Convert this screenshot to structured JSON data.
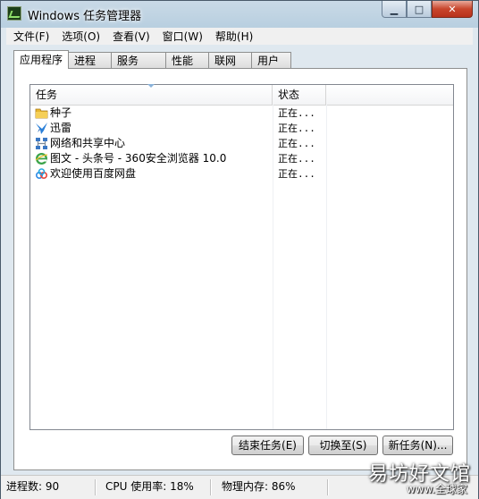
{
  "window": {
    "title": "Windows 任务管理器"
  },
  "menu": [
    "文件(F)",
    "选项(O)",
    "查看(V)",
    "窗口(W)",
    "帮助(H)"
  ],
  "tabs": [
    "应用程序",
    "进程",
    "服务",
    "性能",
    "联网",
    "用户"
  ],
  "columns": {
    "task": "任务",
    "status": "状态"
  },
  "rows": [
    {
      "name": "种子",
      "status": "正在...",
      "icon": "folder-icon"
    },
    {
      "name": "迅雷",
      "status": "正在...",
      "icon": "thunder-bird-icon"
    },
    {
      "name": "网络和共享中心",
      "status": "正在...",
      "icon": "network-icon"
    },
    {
      "name": "图文 - 头条号 - 360安全浏览器 10.0",
      "status": "正在...",
      "icon": "browser-e-icon"
    },
    {
      "name": "欢迎使用百度网盘",
      "status": "正在...",
      "icon": "baidu-cloud-icon"
    }
  ],
  "buttons": {
    "end": "结束任务(E)",
    "switch": "切换至(S)",
    "new": "新任务(N)..."
  },
  "status": {
    "processes": "进程数: 90",
    "cpu": "CPU 使用率: 18%",
    "memory": "物理内存: 86%"
  },
  "watermark": {
    "main": "易坊好文馆",
    "sub": "www.全球家"
  },
  "colors": {
    "title_bg": "#b8cfe0",
    "window_bg": "#dfe8ef",
    "close_button": "#c8452c"
  }
}
